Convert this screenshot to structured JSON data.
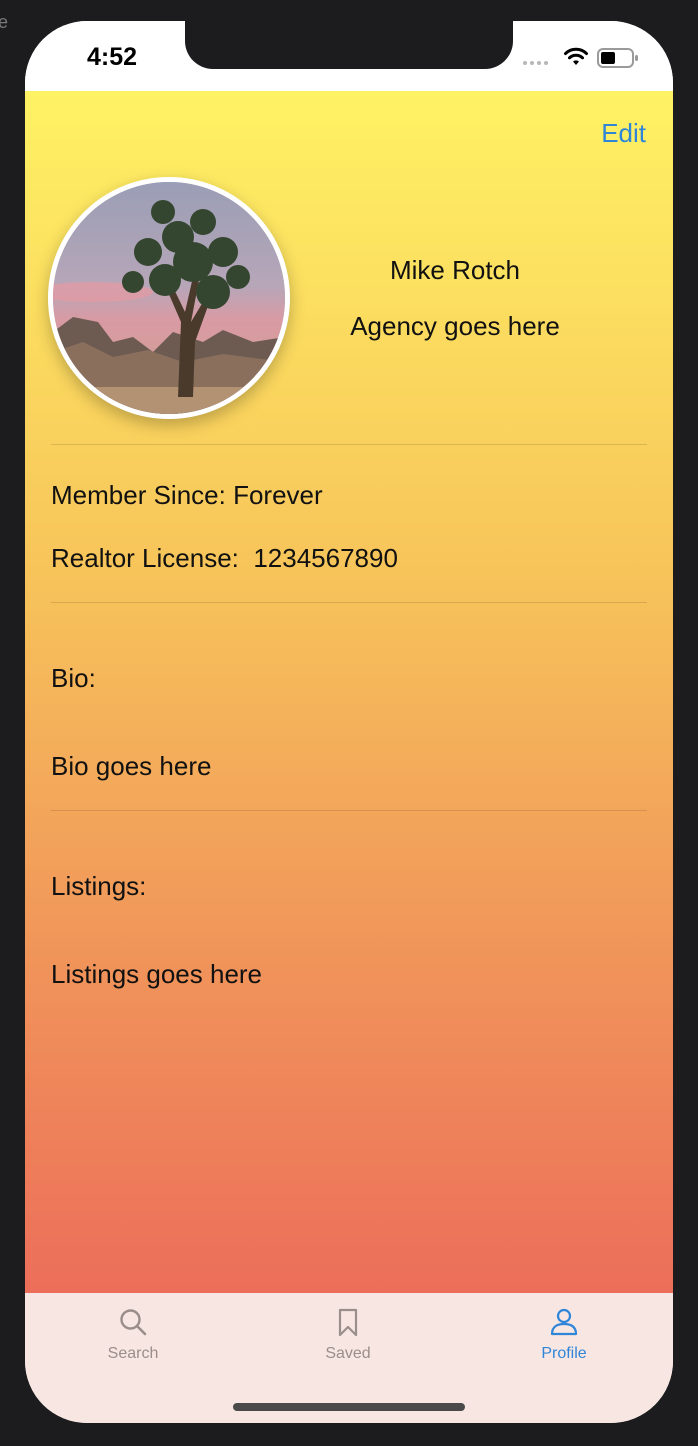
{
  "status_bar": {
    "time": "4:52"
  },
  "header": {
    "edit_label": "Edit"
  },
  "profile": {
    "name": "Mike Rotch",
    "agency": "Agency goes here",
    "member_since": "Member Since: Forever",
    "realtor_license": "Realtor License:  1234567890",
    "bio_label": "Bio:",
    "bio": "Bio goes here",
    "listings_label": "Listings:",
    "listings": "Listings goes here"
  },
  "tab_bar": {
    "items": [
      {
        "label": "Search",
        "icon": "search-icon"
      },
      {
        "label": "Saved",
        "icon": "bookmark-icon"
      },
      {
        "label": "Profile",
        "icon": "person-icon",
        "active": true
      }
    ]
  },
  "colors": {
    "accent": "#2f86d8",
    "gradient_top": "#fff264",
    "gradient_bottom": "#ec6e5a",
    "tab_bar_bg": "#f8e6e2"
  }
}
